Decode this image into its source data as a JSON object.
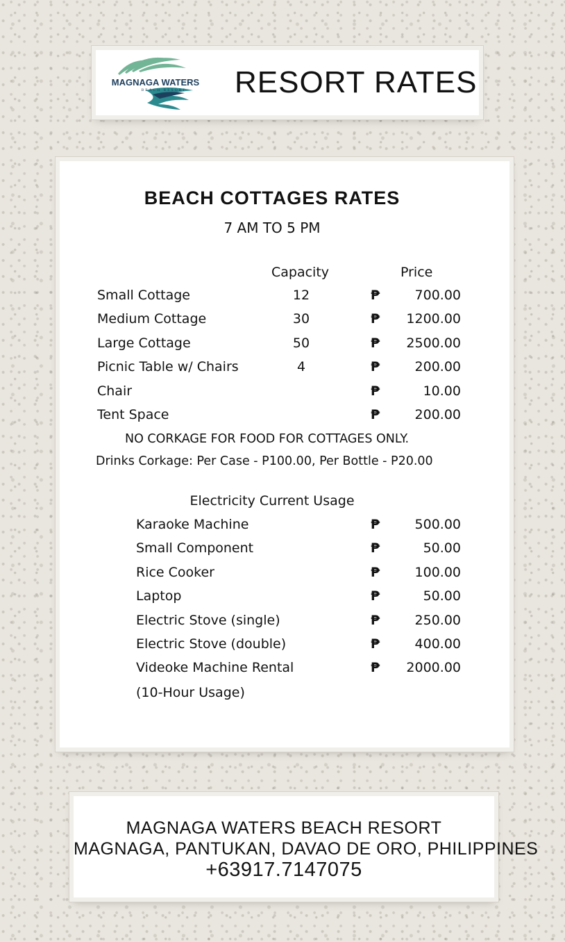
{
  "header": {
    "logo_name": "MAGNAGA WATERS",
    "logo_sub": "BEACH RESORT",
    "title": "RESORT RATES"
  },
  "cottages": {
    "title": "BEACH COTTAGES RATES",
    "hours": "7 AM TO 5 PM",
    "col_capacity": "Capacity",
    "col_price": "Price",
    "currency": "₱",
    "rows": [
      {
        "name": "Small Cottage",
        "capacity": "12",
        "price": "700.00"
      },
      {
        "name": "Medium Cottage",
        "capacity": "30",
        "price": "1200.00"
      },
      {
        "name": "Large Cottage",
        "capacity": "50",
        "price": "2500.00"
      },
      {
        "name": "Picnic Table w/ Chairs",
        "capacity": "4",
        "price": "200.00"
      },
      {
        "name": "Chair",
        "capacity": "",
        "price": "10.00"
      },
      {
        "name": "Tent Space",
        "capacity": "",
        "price": "200.00"
      }
    ],
    "note_corkage_food": "NO CORKAGE FOR FOOD FOR COTTAGES ONLY.",
    "note_corkage_drinks": "Drinks Corkage: Per Case - P100.00, Per Bottle - P20.00"
  },
  "electricity": {
    "title": "Electricity Current Usage",
    "rows": [
      {
        "name": "Karaoke Machine",
        "price": "500.00"
      },
      {
        "name": "Small Component",
        "price": "50.00"
      },
      {
        "name": "Rice Cooker",
        "price": "100.00"
      },
      {
        "name": "Laptop",
        "price": "50.00"
      },
      {
        "name": "Electric Stove (single)",
        "price": "250.00"
      },
      {
        "name": "Electric Stove (double)",
        "price": "400.00"
      },
      {
        "name": "Videoke Machine Rental",
        "price": "2000.00"
      }
    ],
    "videoke_note": "(10-Hour Usage)"
  },
  "footer": {
    "name": "MAGNAGA WATERS BEACH RESORT",
    "address": "MAGNAGA, PANTUKAN, DAVAO DE ORO, PHILIPPINES",
    "phone": "+63917.7147075"
  },
  "colors": {
    "logo_teal": "#2a8a8e",
    "logo_green": "#5aa884",
    "logo_navy": "#1d3f5e"
  }
}
